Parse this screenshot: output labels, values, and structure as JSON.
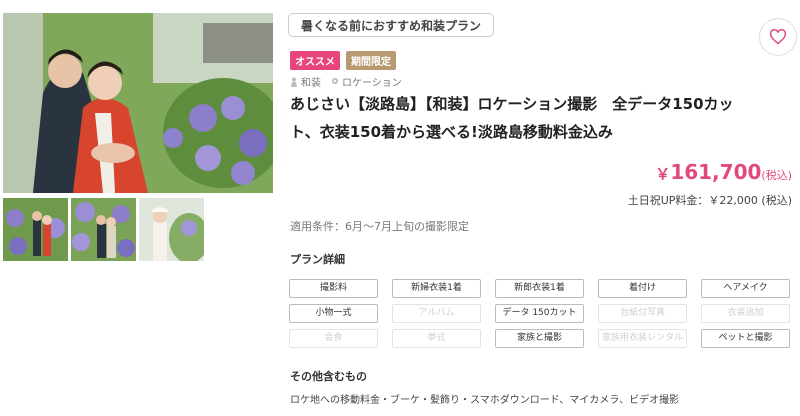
{
  "catch_copy": "暑くなる前におすすめ和装プラン",
  "badges": [
    "オススメ",
    "期間限定"
  ],
  "tags": [
    "和装",
    "ロケーション"
  ],
  "title": "あじさい【淡路島】【和装】ロケーション撮影　全データ150カット、衣装150着から選べる!淡路島移動料金込み",
  "price": {
    "yen": "￥",
    "amount": "161,700",
    "tax": "(税込)"
  },
  "holiday_price": "土日祝UP料金：￥22,000 (税込)",
  "conditions": "適用条件：6月〜7月上旬の撮影限定",
  "plan_details_title": "プラン詳細",
  "plan_items": [
    {
      "label": "撮影料",
      "active": true
    },
    {
      "label": "新婦衣装1着",
      "active": true
    },
    {
      "label": "新郎衣装1着",
      "active": true
    },
    {
      "label": "着付け",
      "active": true
    },
    {
      "label": "ヘアメイク",
      "active": true
    },
    {
      "label": "小物一式",
      "active": true
    },
    {
      "label": "アルバム",
      "active": false
    },
    {
      "label": "データ 150カット",
      "active": true
    },
    {
      "label": "台紙付写真",
      "active": false
    },
    {
      "label": "衣装追加",
      "active": false
    },
    {
      "label": "会食",
      "active": false
    },
    {
      "label": "挙式",
      "active": false
    },
    {
      "label": "家族と撮影",
      "active": true
    },
    {
      "label": "家族用衣装レンタル",
      "active": false
    },
    {
      "label": "ペットと撮影",
      "active": true
    }
  ],
  "other_title": "その他含むもの",
  "other_text": "ロケ地への移動料金・ブーケ・髪飾り・スマホダウンロード、マイカメラ、ビデオ撮影",
  "icons": {
    "favorite": "heart-icon",
    "tag": "person-icon",
    "location": "pin-icon"
  },
  "colors": {
    "accent": "#e04a7a",
    "badge_pink": "#e8457a",
    "badge_tan": "#b89a72"
  }
}
